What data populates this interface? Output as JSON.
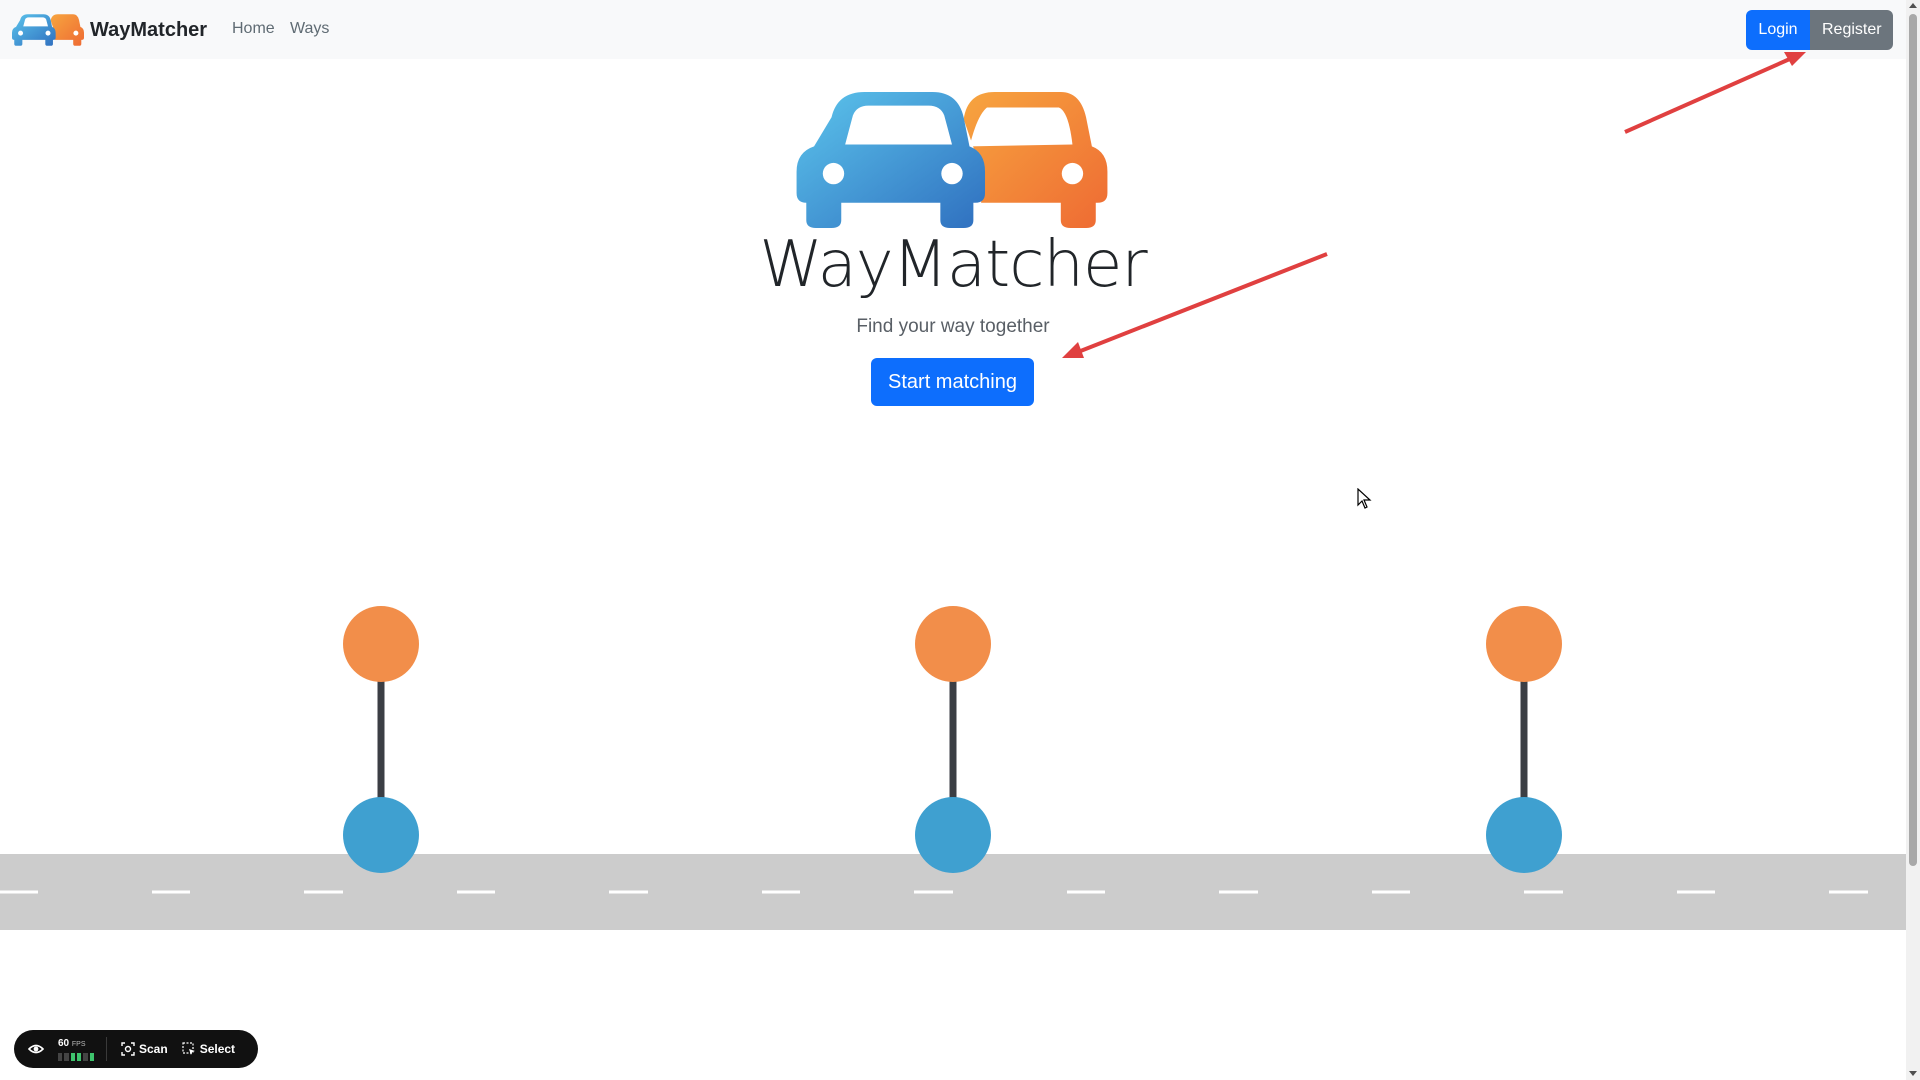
{
  "navbar": {
    "brand": "WayMatcher",
    "links": [
      "Home",
      "Ways"
    ],
    "login_label": "Login",
    "register_label": "Register"
  },
  "hero": {
    "title": "WayMatcher",
    "tagline": "Find your way together",
    "cta_label": "Start matching"
  },
  "colors": {
    "primary": "#0d6efd",
    "secondary": "#6c757d",
    "orange": "#f28e4a",
    "blue": "#3fa0d0",
    "road": "#cccccc",
    "annotation": "#e04040"
  },
  "devtools": {
    "fps_value": "60",
    "fps_unit": "FPS",
    "scan_label": "Scan",
    "select_label": "Select"
  },
  "icons": [
    "car-logo-icon",
    "eye-icon",
    "scan-icon",
    "select-icon",
    "cursor-icon"
  ]
}
